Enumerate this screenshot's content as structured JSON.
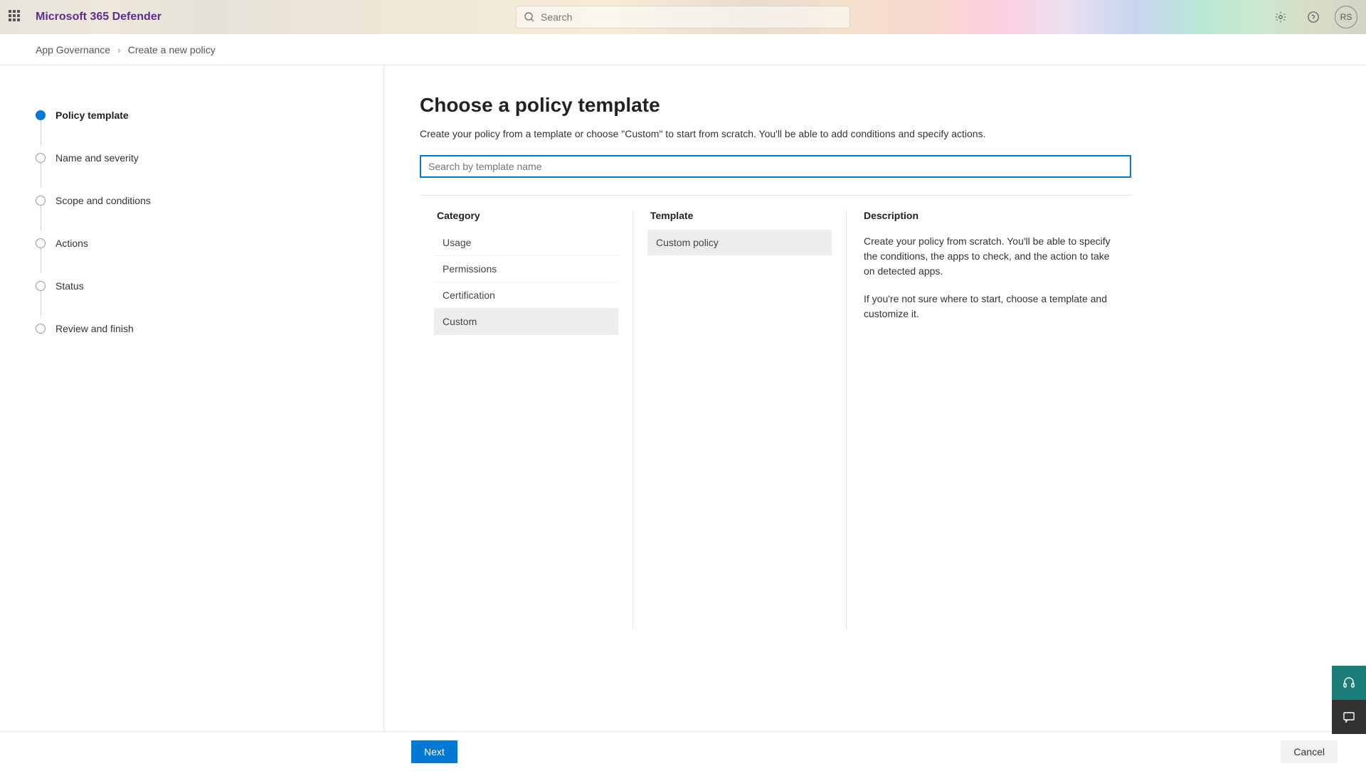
{
  "header": {
    "app_title": "Microsoft 365 Defender",
    "search_placeholder": "Search",
    "avatar_initials": "RS"
  },
  "breadcrumb": {
    "root": "App Governance",
    "current": "Create a new policy"
  },
  "steps": [
    {
      "label": "Policy template",
      "active": true
    },
    {
      "label": "Name and severity",
      "active": false
    },
    {
      "label": "Scope and conditions",
      "active": false
    },
    {
      "label": "Actions",
      "active": false
    },
    {
      "label": "Status",
      "active": false
    },
    {
      "label": "Review and finish",
      "active": false
    }
  ],
  "main": {
    "title": "Choose a policy template",
    "subtitle": "Create your policy from a template or choose \"Custom\" to start from scratch. You'll be able to add conditions and specify actions.",
    "search_placeholder": "Search by template name",
    "category_header": "Category",
    "template_header": "Template",
    "description_header": "Description",
    "categories": [
      {
        "label": "Usage",
        "selected": false
      },
      {
        "label": "Permissions",
        "selected": false
      },
      {
        "label": "Certification",
        "selected": false
      },
      {
        "label": "Custom",
        "selected": true
      }
    ],
    "templates": [
      {
        "label": "Custom policy",
        "selected": true
      }
    ],
    "description_p1": "Create your policy from scratch. You'll be able to specify the conditions, the apps to check, and the action to take on detected apps.",
    "description_p2": "If you're not sure where to start, choose a template and customize it."
  },
  "footer": {
    "next": "Next",
    "cancel": "Cancel"
  }
}
